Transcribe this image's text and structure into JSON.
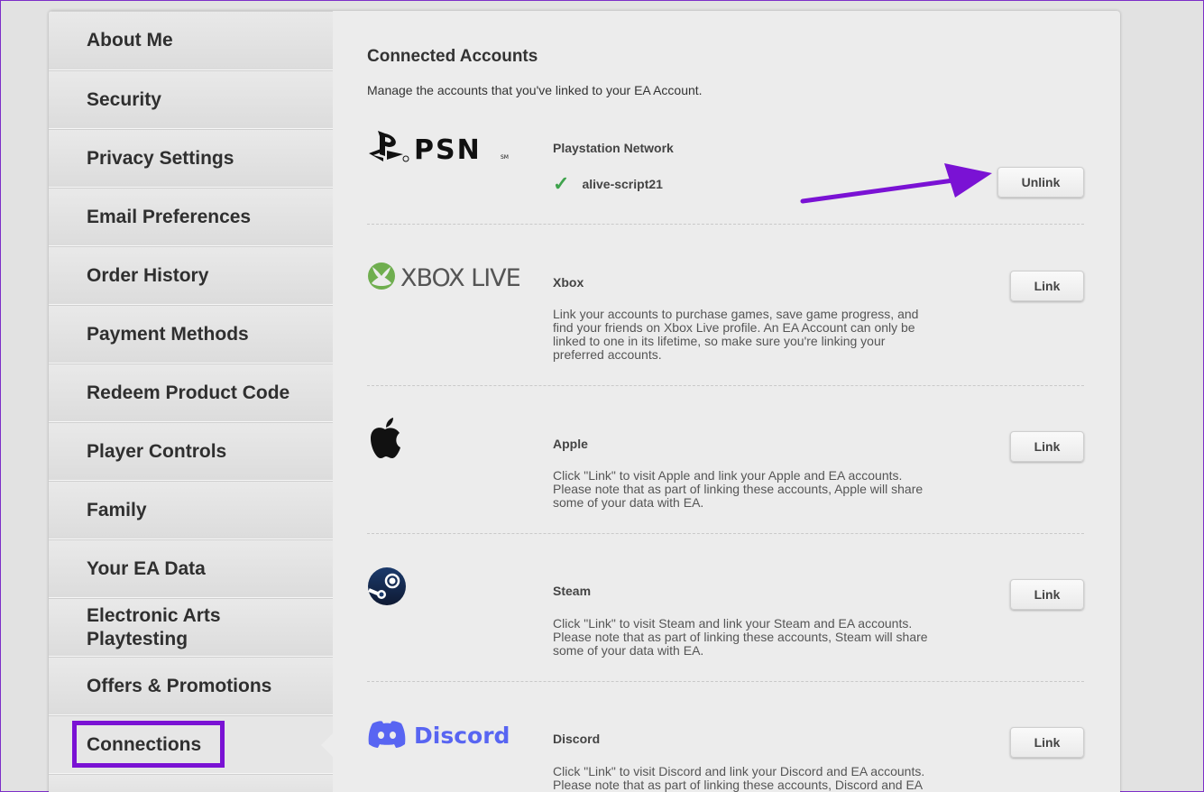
{
  "sidebar": {
    "items": [
      {
        "label": "About Me"
      },
      {
        "label": "Security"
      },
      {
        "label": "Privacy Settings"
      },
      {
        "label": "Email Preferences"
      },
      {
        "label": "Order History"
      },
      {
        "label": "Payment Methods"
      },
      {
        "label": "Redeem Product Code"
      },
      {
        "label": "Player Controls"
      },
      {
        "label": "Family"
      },
      {
        "label": "Your EA Data"
      },
      {
        "label": "Electronic Arts Playtesting"
      },
      {
        "label": "Offers & Promotions"
      },
      {
        "label": "Connections"
      }
    ],
    "active": "Connections"
  },
  "main": {
    "title": "Connected Accounts",
    "subtitle": "Manage the accounts that you've linked to your EA Account.",
    "services": [
      {
        "name": "Playstation Network",
        "logo_text": "PSN",
        "linked_user": "alive-script21",
        "button": "Unlink",
        "icon": "playstation-logo"
      },
      {
        "name": "Xbox",
        "logo_text": "XBOX LIVE",
        "desc": "Link your accounts to purchase games, save game progress, and find your friends on Xbox Live profile. An EA Account can only be linked to one in its lifetime, so make sure you're linking your preferred accounts.",
        "button": "Link",
        "icon": "xbox-logo"
      },
      {
        "name": "Apple",
        "desc": "Click \"Link\" to visit Apple and link your Apple and EA accounts. Please note that as part of linking these accounts, Apple will share some of your data with EA.",
        "button": "Link",
        "icon": "apple-logo"
      },
      {
        "name": "Steam",
        "desc": "Click \"Link\" to visit Steam and link your Steam and EA accounts. Please note that as part of linking these accounts, Steam will share some of your data with EA.",
        "button": "Link",
        "icon": "steam-logo"
      },
      {
        "name": "Discord",
        "logo_text": "Discord",
        "desc": "Click \"Link\" to visit Discord and link your Discord and EA accounts. Please note that as part of linking these accounts, Discord and EA will share some of your data with one",
        "button": "Link",
        "icon": "discord-logo"
      }
    ]
  },
  "colors": {
    "annotation": "#7a12d4",
    "check": "#3fa34d",
    "discord": "#5865f2",
    "xbox": "#6fae4f"
  }
}
